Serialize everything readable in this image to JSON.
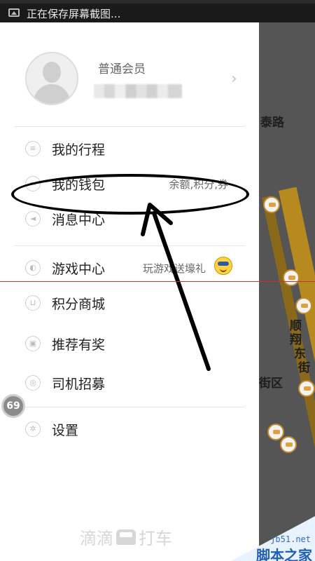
{
  "status_bar": {
    "notification_text": "正在保存屏幕截图..."
  },
  "profile": {
    "member_level": "普通会员"
  },
  "menu": {
    "items": [
      {
        "label": "我的行程",
        "icon": "list-icon",
        "sub": ""
      },
      {
        "label": "我的钱包",
        "icon": "wallet-icon",
        "sub": "余额,积分,券"
      },
      {
        "label": "消息中心",
        "icon": "megaphone-icon",
        "sub": ""
      },
      {
        "label": "游戏中心",
        "icon": "game-icon",
        "sub": "玩游戏送壕礼"
      },
      {
        "label": "积分商城",
        "icon": "cart-icon",
        "sub": ""
      },
      {
        "label": "推荐有奖",
        "icon": "gift-icon",
        "sub": ""
      },
      {
        "label": "司机招募",
        "icon": "steering-wheel-icon",
        "sub": ""
      },
      {
        "label": "设置",
        "icon": "gear-icon",
        "sub": ""
      }
    ]
  },
  "map": {
    "street_labels": [
      "泰路",
      "顺",
      "翔",
      "东",
      "街",
      "街区"
    ]
  },
  "side_bubble": {
    "value": "69"
  },
  "brand": {
    "left": "滴滴",
    "right": "打车"
  },
  "watermark": {
    "url": "jb51.net",
    "name": "脚本之家"
  },
  "colors": {
    "drawer_bg": "#ffffff",
    "text_primary": "#222222",
    "text_secondary": "#666666",
    "annotation": "#000000",
    "map_road": "#b78a1f"
  }
}
